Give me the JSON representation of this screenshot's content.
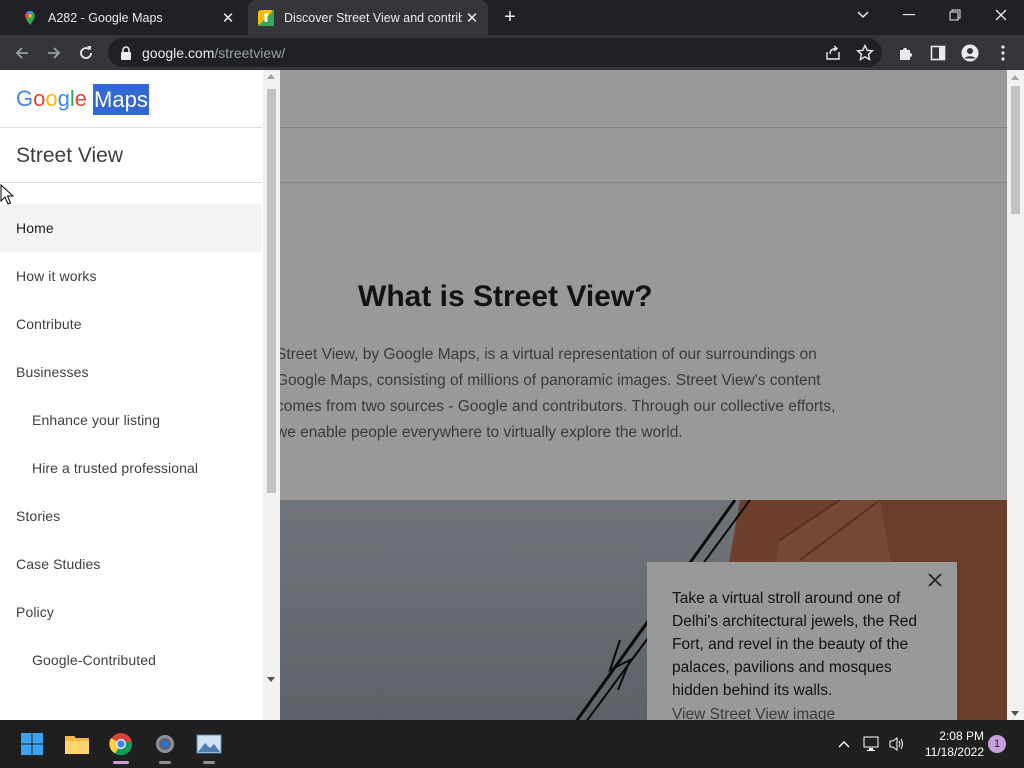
{
  "browser": {
    "tabs": [
      {
        "title": "A282 - Google Maps",
        "favicon": "maps-pin-icon",
        "active": false
      },
      {
        "title": "Discover Street View and contrib",
        "favicon": "street-view-icon",
        "active": true
      }
    ],
    "url_host": "google.com",
    "url_path": "/streetview/"
  },
  "sidebar": {
    "logo_google": "Google",
    "logo_maps": "Maps",
    "section_title": "Street View",
    "items": [
      {
        "label": "Home",
        "active": true,
        "sub": false
      },
      {
        "label": "How it works",
        "sub": false
      },
      {
        "label": "Contribute",
        "sub": false
      },
      {
        "label": "Businesses",
        "sub": false
      },
      {
        "label": "Enhance your listing",
        "sub": true
      },
      {
        "label": "Hire a trusted professional",
        "sub": true
      },
      {
        "label": "Stories",
        "sub": false
      },
      {
        "label": "Case Studies",
        "sub": false
      },
      {
        "label": "Policy",
        "sub": false
      },
      {
        "label": "Google-Contributed",
        "sub": true
      }
    ]
  },
  "main": {
    "heading": "What is Street View?",
    "paragraph": "Street View, by Google Maps, is a virtual representation of our surroundings on Google Maps, consisting of millions of panoramic images. Street View's content comes from two sources - Google and contributors. Through our collective efforts, we enable people everywhere to virtually explore the world.",
    "card": {
      "text": "Take a virtual stroll around one of Delhi's architectural jewels, the Red Fort, and revel in the beauty of the palaces, pavilions and mosques hidden behind its walls.",
      "link": "View Street View image"
    }
  },
  "taskbar": {
    "time": "2:08 PM",
    "date": "11/18/2022",
    "notifications": "1"
  },
  "colors": {
    "chrome_dark": "#202124",
    "chrome_toolbar": "#35363a",
    "maps_highlight": "#3367d6",
    "overlay": "rgba(0,0,0,0.40)"
  }
}
